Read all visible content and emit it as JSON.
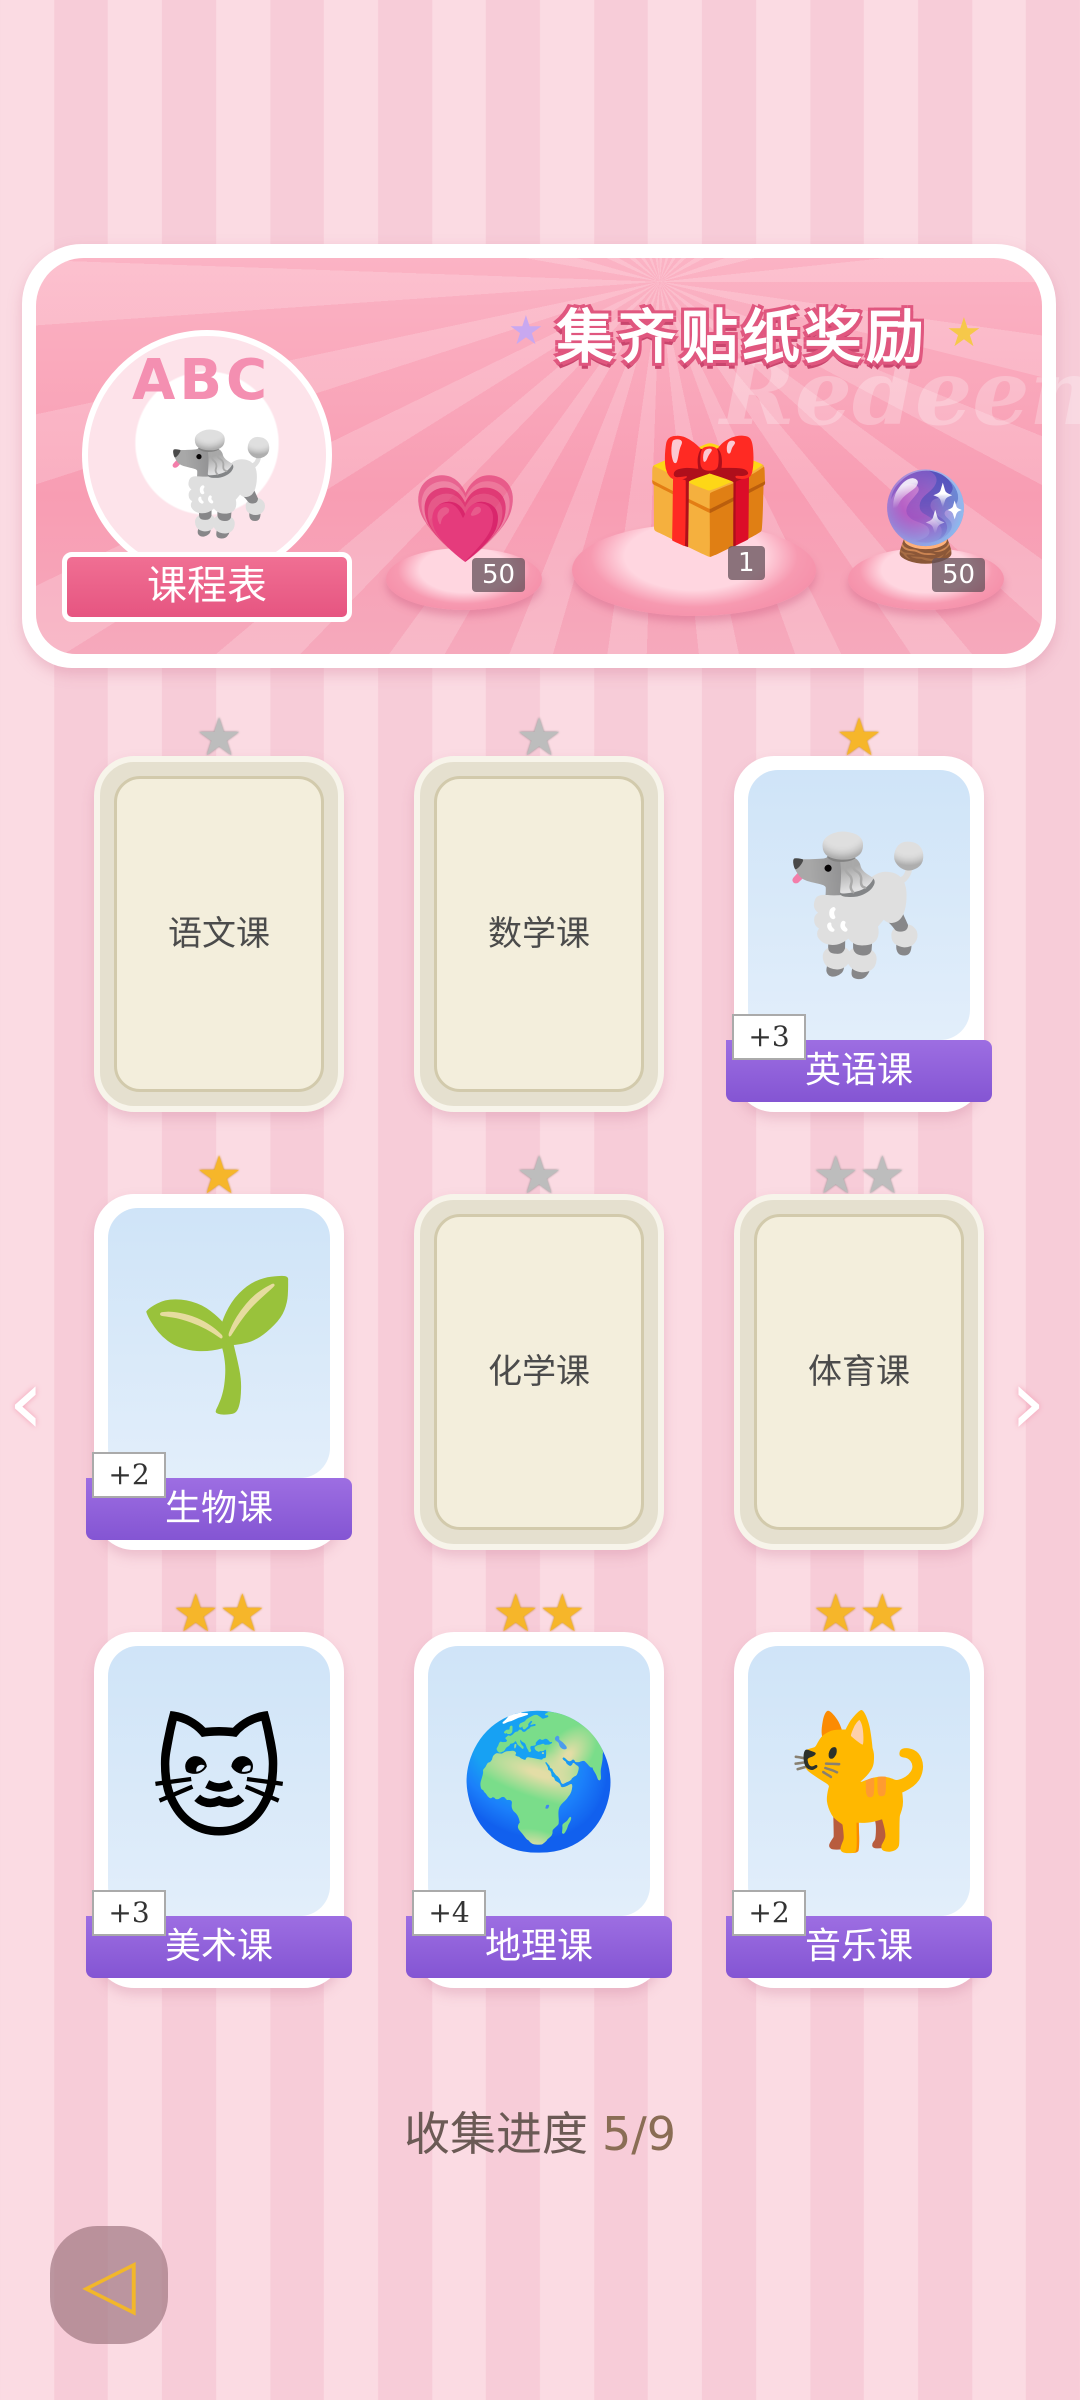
{
  "banner": {
    "title": "集齐贴纸奖励",
    "watermark": "Redeem",
    "timetable": {
      "abc": "ABC",
      "label": "课程表"
    },
    "rewards": [
      {
        "icon": "pink-heart-gem-icon",
        "glyph": "💗",
        "count": "50"
      },
      {
        "icon": "gift-box-icon",
        "glyph": "🎁",
        "count": "1"
      },
      {
        "icon": "energy-orb-icon",
        "glyph": "🔮",
        "count": "50"
      }
    ]
  },
  "cards": [
    {
      "name": "语文课",
      "unlocked": false,
      "stars": "grey",
      "star_count": 1
    },
    {
      "name": "数学课",
      "unlocked": false,
      "stars": "grey",
      "star_count": 1
    },
    {
      "name": "英语课",
      "unlocked": true,
      "bonus": "+3",
      "art": "🐩",
      "stars": "gold",
      "star_count": 1
    },
    {
      "name": "生物课",
      "unlocked": true,
      "bonus": "+2",
      "art": "🌱",
      "stars": "gold",
      "star_count": 1
    },
    {
      "name": "化学课",
      "unlocked": false,
      "stars": "grey",
      "star_count": 1
    },
    {
      "name": "体育课",
      "unlocked": false,
      "stars": "grey",
      "star_count": 2
    },
    {
      "name": "美术课",
      "unlocked": true,
      "bonus": "+3",
      "art": "🐱",
      "stars": "gold",
      "star_count": 2
    },
    {
      "name": "地理课",
      "unlocked": true,
      "bonus": "+4",
      "art": "🌍",
      "stars": "gold",
      "star_count": 2
    },
    {
      "name": "音乐课",
      "unlocked": true,
      "bonus": "+2",
      "art": "🐈",
      "stars": "gold",
      "star_count": 2
    }
  ],
  "progress": {
    "label": "收集进度",
    "value": "5/9"
  },
  "nav": {
    "prev": "‹",
    "next": "›",
    "back": "◁"
  },
  "colors": {
    "accent": "#8455d3",
    "star_gold": "#f6b62a",
    "banner_pink": "#f89db3"
  }
}
